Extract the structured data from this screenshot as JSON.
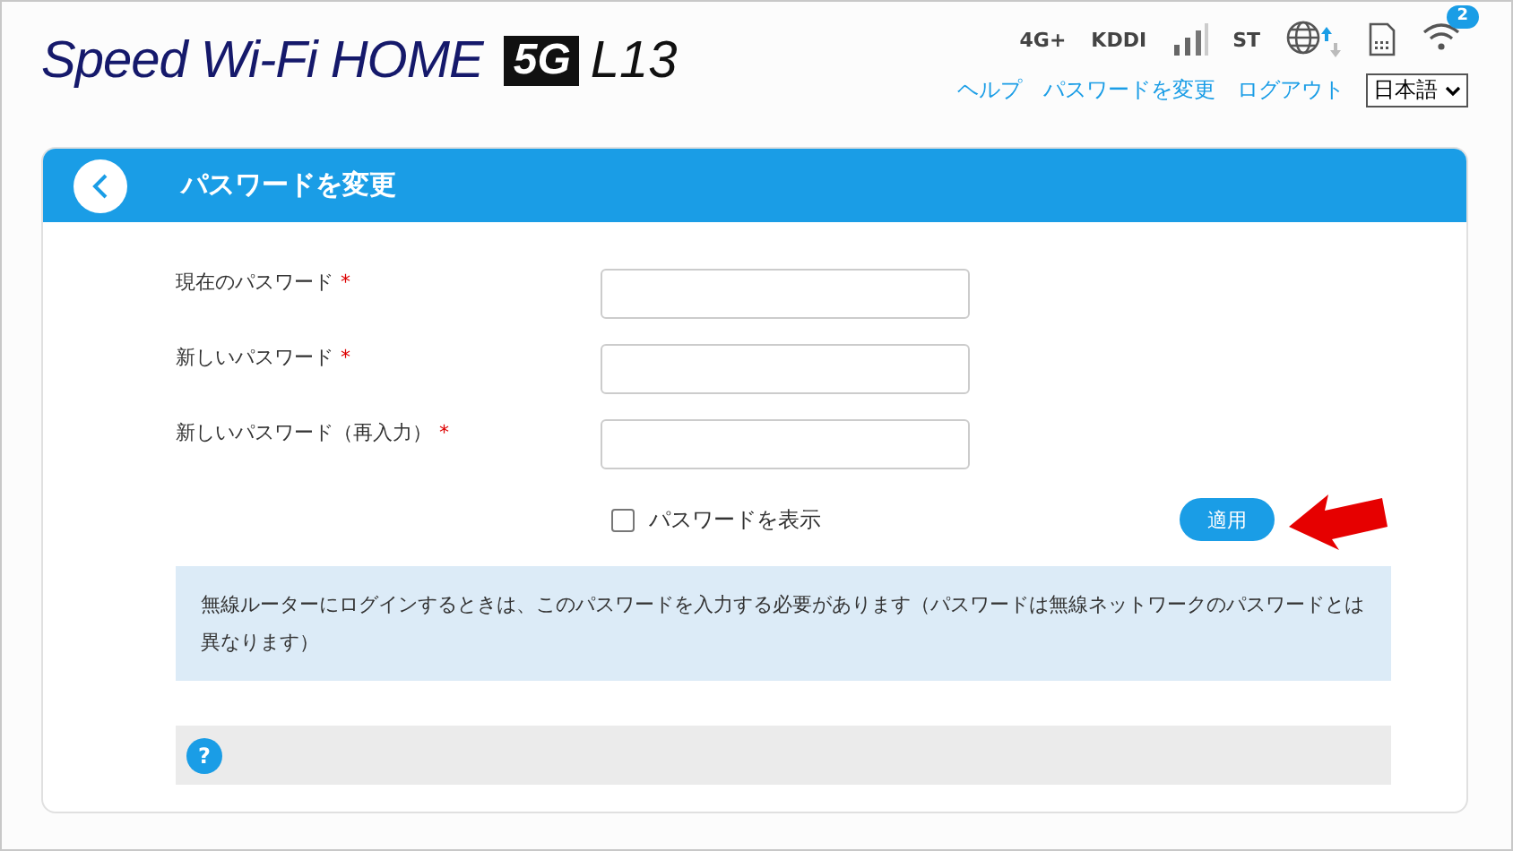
{
  "header": {
    "logo": {
      "brand": "Speed Wi-Fi HOME",
      "badge": "5G",
      "model": "L13"
    },
    "status": [
      {
        "kind": "text",
        "text": "4G+"
      },
      {
        "kind": "text",
        "text": "KDDI"
      },
      {
        "kind": "signal"
      },
      {
        "kind": "text",
        "text": "ST"
      },
      {
        "kind": "globe"
      },
      {
        "kind": "sim"
      },
      {
        "kind": "wifi",
        "badge": "2"
      }
    ],
    "links": [
      {
        "label": "ヘルプ"
      },
      {
        "label": "パスワードを変更"
      },
      {
        "label": "ログアウト"
      }
    ],
    "language": {
      "value": "日本語"
    }
  },
  "panel": {
    "title": "パスワードを変更",
    "fields": [
      {
        "label": "現在のパスワード",
        "required_mark": "*"
      },
      {
        "label": "新しいパスワード",
        "required_mark": "*"
      },
      {
        "label": "新しいパスワード（再入力）",
        "required_mark": "*"
      }
    ],
    "show_password": {
      "label": "パスワードを表示",
      "checked": false
    },
    "apply_button": "適用",
    "info": "無線ルーターにログインするときは、このパスワードを入力する必要があります（パスワードは無線ネットワークのパスワードとは異なります）",
    "help": "?"
  }
}
